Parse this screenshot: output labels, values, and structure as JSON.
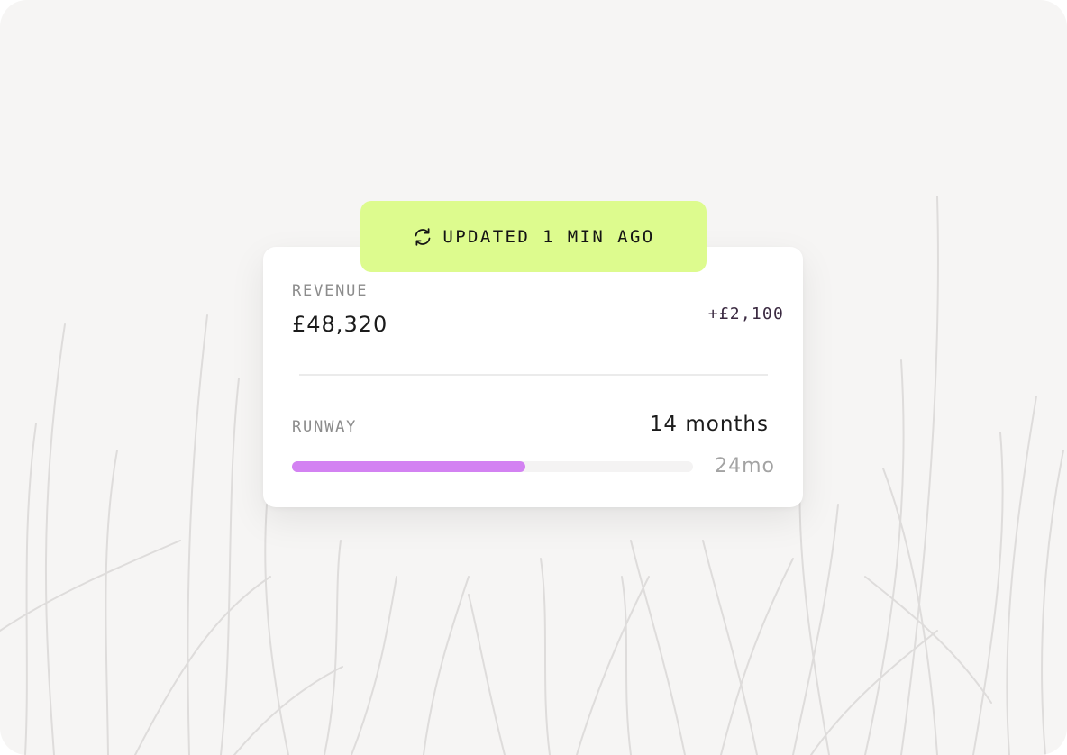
{
  "status_badge": {
    "icon": "refresh-icon",
    "text": "UPDATED 1 MIN AGO",
    "color": "#ddfb8e"
  },
  "revenue": {
    "label": "REVENUE",
    "value": "£48,320",
    "delta": "+£2,100"
  },
  "runway": {
    "label": "RUNWAY",
    "value": "14 months",
    "max_label": "24mo",
    "progress": 0.583,
    "bar_color": "#d382f2"
  }
}
